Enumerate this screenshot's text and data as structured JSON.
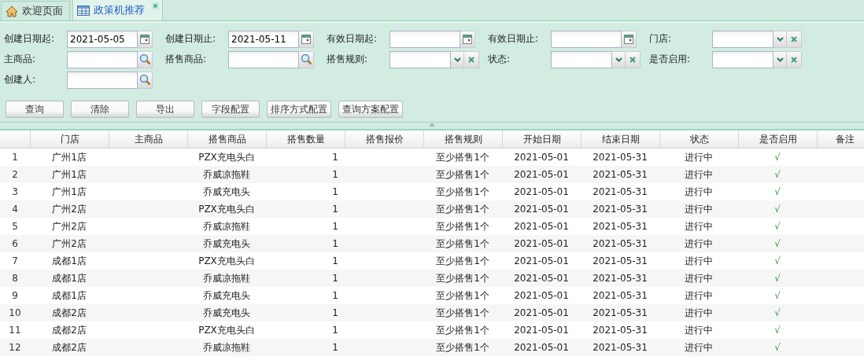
{
  "tabs": [
    {
      "label": "欢迎页面",
      "kind": "home",
      "selected": false,
      "closable": false
    },
    {
      "label": "政策机推荐",
      "kind": "table",
      "selected": true,
      "closable": true
    }
  ],
  "filters": [
    {
      "label": "创建日期起:",
      "kind": "date",
      "value": "2021-05-05"
    },
    {
      "label": "创建日期止:",
      "kind": "date",
      "value": "2021-05-11"
    },
    {
      "label": "有效日期起:",
      "kind": "date"
    },
    {
      "label": "有效日期止:",
      "kind": "date"
    },
    {
      "label": "门店:",
      "kind": "select"
    },
    {
      "label": "主商品:",
      "kind": "lookup"
    },
    {
      "label": "搭售商品:",
      "kind": "lookup"
    },
    {
      "label": "搭售规则:",
      "kind": "select"
    },
    {
      "label": "状态:",
      "kind": "select"
    },
    {
      "label": "是否启用:",
      "kind": "select"
    },
    {
      "label": "创建人:",
      "kind": "lookup"
    }
  ],
  "buttons": [
    "查询",
    "清除",
    "导出",
    "字段配置",
    "排序方式配置",
    "查询方案配置"
  ],
  "table": {
    "columns": [
      "门店",
      "主商品",
      "搭售商品",
      "搭售数量",
      "搭售报价",
      "搭售规则",
      "开始日期",
      "结束日期",
      "状态",
      "是否启用",
      "备注"
    ],
    "rows": [
      {
        "number": "1",
        "cells": [
          "广州1店",
          "",
          "PZX充电头白",
          "1",
          "",
          "至少搭售1个",
          "2021-05-01",
          "2021-05-31",
          "进行中",
          "√",
          ""
        ]
      },
      {
        "number": "2",
        "cells": [
          "广州1店",
          "",
          "乔威凉拖鞋",
          "1",
          "",
          "至少搭售1个",
          "2021-05-01",
          "2021-05-31",
          "进行中",
          "√",
          ""
        ]
      },
      {
        "number": "3",
        "cells": [
          "广州1店",
          "",
          "乔威充电头",
          "1",
          "",
          "至少搭售1个",
          "2021-05-01",
          "2021-05-31",
          "进行中",
          "√",
          ""
        ]
      },
      {
        "number": "4",
        "cells": [
          "广州2店",
          "",
          "PZX充电头白",
          "1",
          "",
          "至少搭售1个",
          "2021-05-01",
          "2021-05-31",
          "进行中",
          "√",
          ""
        ]
      },
      {
        "number": "5",
        "cells": [
          "广州2店",
          "",
          "乔威凉拖鞋",
          "1",
          "",
          "至少搭售1个",
          "2021-05-01",
          "2021-05-31",
          "进行中",
          "√",
          ""
        ]
      },
      {
        "number": "6",
        "cells": [
          "广州2店",
          "",
          "乔威充电头",
          "1",
          "",
          "至少搭售1个",
          "2021-05-01",
          "2021-05-31",
          "进行中",
          "√",
          ""
        ]
      },
      {
        "number": "7",
        "cells": [
          "成都1店",
          "",
          "PZX充电头白",
          "1",
          "",
          "至少搭售1个",
          "2021-05-01",
          "2021-05-31",
          "进行中",
          "√",
          ""
        ]
      },
      {
        "number": "8",
        "cells": [
          "成都1店",
          "",
          "乔威凉拖鞋",
          "1",
          "",
          "至少搭售1个",
          "2021-05-01",
          "2021-05-31",
          "进行中",
          "√",
          ""
        ]
      },
      {
        "number": "9",
        "cells": [
          "成都1店",
          "",
          "乔威充电头",
          "1",
          "",
          "至少搭售1个",
          "2021-05-01",
          "2021-05-31",
          "进行中",
          "√",
          ""
        ]
      },
      {
        "number": "10",
        "cells": [
          "成都2店",
          "",
          "乔威充电头",
          "1",
          "",
          "至少搭售1个",
          "2021-05-01",
          "2021-05-31",
          "进行中",
          "√",
          ""
        ]
      },
      {
        "number": "11",
        "cells": [
          "成都2店",
          "",
          "PZX充电头白",
          "1",
          "",
          "至少搭售1个",
          "2021-05-01",
          "2021-05-31",
          "进行中",
          "√",
          ""
        ]
      },
      {
        "number": "12",
        "cells": [
          "成都2店",
          "",
          "乔威凉拖鞋",
          "1",
          "",
          "至少搭售1个",
          "2021-05-01",
          "2021-05-31",
          "进行中",
          "√",
          ""
        ]
      }
    ]
  }
}
